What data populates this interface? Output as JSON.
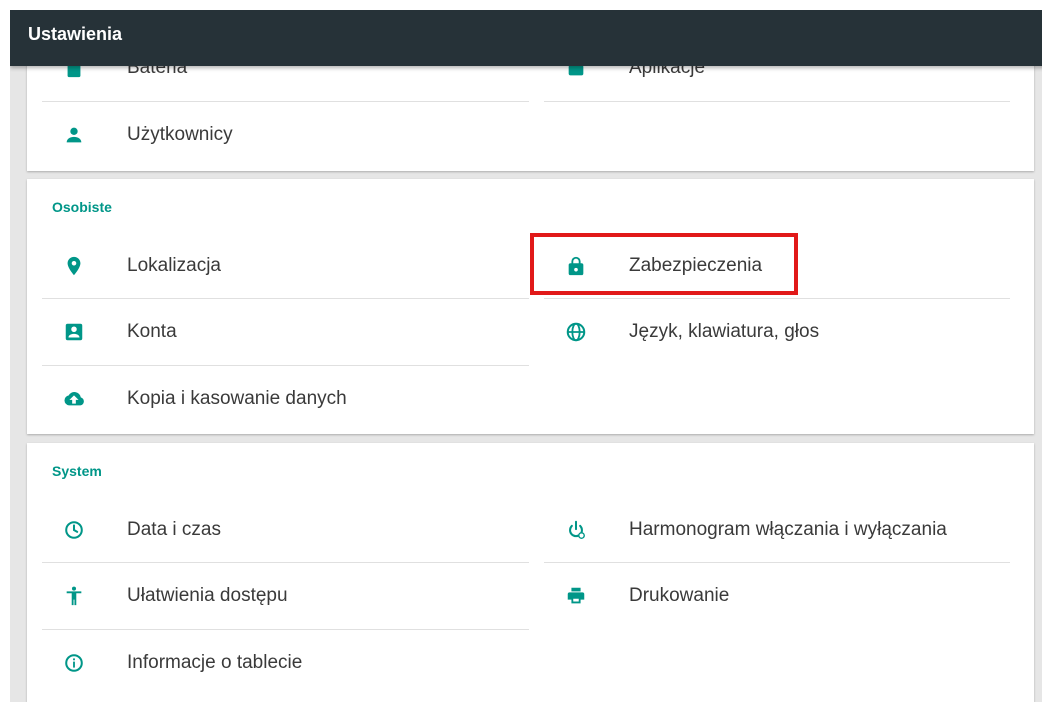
{
  "appbar": {
    "title": "Ustawienia"
  },
  "device_section": {
    "items": [
      {
        "label": "Bateria",
        "icon": "battery-icon"
      },
      {
        "label": "Aplikacje",
        "icon": "android-icon"
      },
      {
        "label": "Użytkownicy",
        "icon": "person-icon"
      }
    ]
  },
  "personal_section": {
    "title": "Osobiste",
    "items": [
      {
        "label": "Lokalizacja",
        "icon": "location-pin-icon"
      },
      {
        "label": "Zabezpieczenia",
        "icon": "lock-icon"
      },
      {
        "label": "Konta",
        "icon": "account-box-icon"
      },
      {
        "label": "Język, klawiatura, głos",
        "icon": "globe-icon"
      },
      {
        "label": "Kopia i kasowanie danych",
        "icon": "cloud-upload-icon"
      }
    ]
  },
  "system_section": {
    "title": "System",
    "items": [
      {
        "label": "Data i czas",
        "icon": "clock-icon"
      },
      {
        "label": "Harmonogram włączania i wyłączania",
        "icon": "power-schedule-icon"
      },
      {
        "label": "Ułatwienia dostępu",
        "icon": "accessibility-icon"
      },
      {
        "label": "Drukowanie",
        "icon": "print-icon"
      },
      {
        "label": "Informacje o tablecie",
        "icon": "info-icon"
      }
    ]
  },
  "colors": {
    "accent": "#009688",
    "appbar": "#263238",
    "highlight": "#e11919"
  }
}
